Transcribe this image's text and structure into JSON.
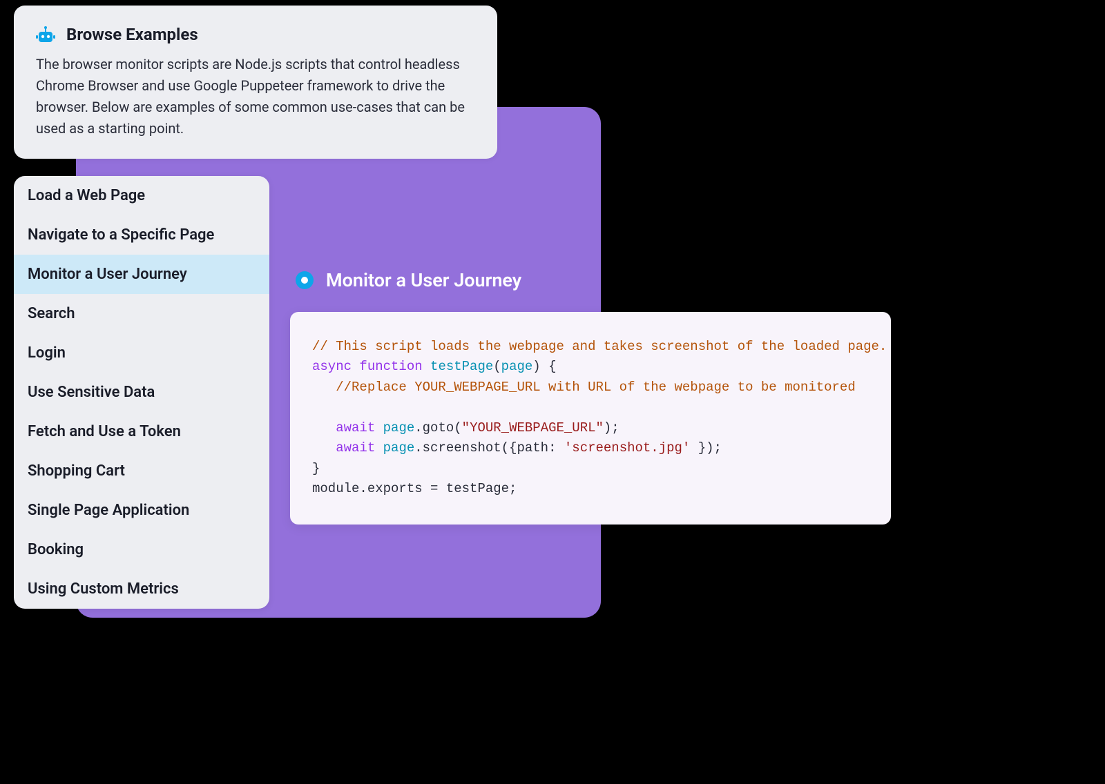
{
  "header": {
    "title": "Browse Examples",
    "description": "The browser monitor scripts are Node.js scripts that control headless Chrome Browser and use Google Puppeteer framework to drive the browser. Below are examples of some common use-cases that can be used as a starting point."
  },
  "sidebar": {
    "items": [
      {
        "label": "Load a Web Page",
        "selected": false
      },
      {
        "label": "Navigate to a Specific Page",
        "selected": false
      },
      {
        "label": "Monitor a User Journey",
        "selected": true
      },
      {
        "label": "Search",
        "selected": false
      },
      {
        "label": "Login",
        "selected": false
      },
      {
        "label": "Use Sensitive Data",
        "selected": false
      },
      {
        "label": "Fetch and Use a Token",
        "selected": false
      },
      {
        "label": "Shopping Cart",
        "selected": false
      },
      {
        "label": "Single Page Application",
        "selected": false
      },
      {
        "label": "Booking",
        "selected": false
      },
      {
        "label": "Using Custom Metrics",
        "selected": false
      }
    ]
  },
  "content": {
    "title": "Monitor a User Journey",
    "code": {
      "line1_comment": "// This script loads the webpage and takes screenshot of the loaded page.",
      "line2_async": "async",
      "line2_function": "function",
      "line2_name": "testPage",
      "line2_open": "(",
      "line2_param": "page",
      "line2_close": ") {",
      "line3_comment": "   //Replace YOUR_WEBPAGE_URL with URL of the webpage to be monitored",
      "line5_indent": "   ",
      "line5_await": "await",
      "line5_page": "page",
      "line5_dot_goto": ".goto(",
      "line5_url": "\"YOUR_WEBPAGE_URL\"",
      "line5_end": ");",
      "line6_indent": "   ",
      "line6_await": "await",
      "line6_page": "page",
      "line6_dot_ss": ".screenshot({path: ",
      "line6_path": "'screenshot.jpg'",
      "line6_end": " });",
      "line7_brace": "}",
      "line8": "module.exports = testPage;"
    }
  },
  "colors": {
    "accent_blue": "#0EA5E9",
    "purple_bg": "#9370DB",
    "selected_bg": "#CDE9F8"
  }
}
